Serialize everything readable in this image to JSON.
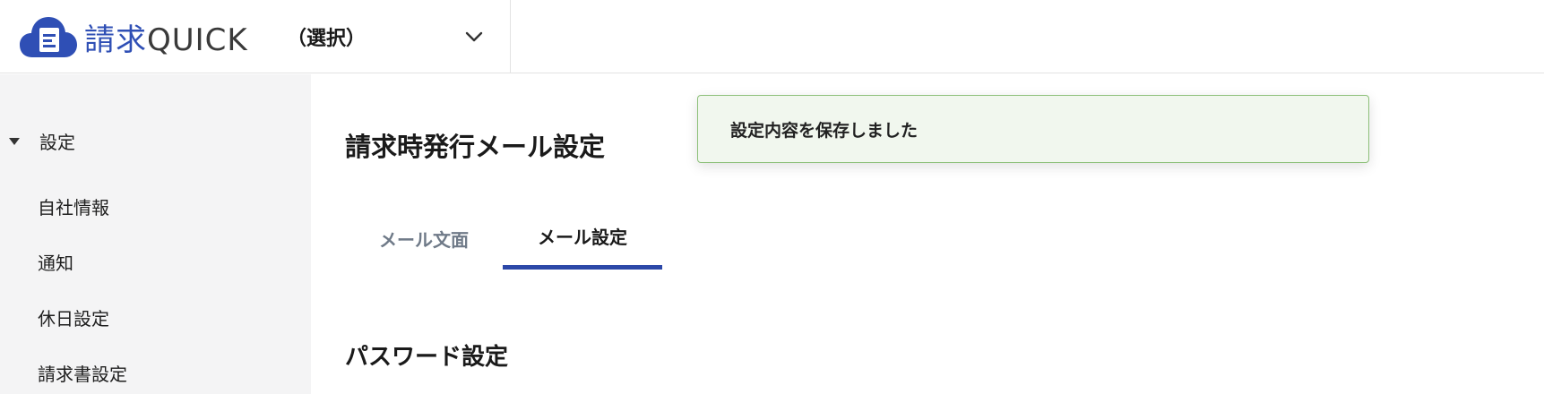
{
  "header": {
    "logo_kanji": "請求",
    "logo_latin": "QUICK",
    "company_select_label": "（選択）",
    "brand_color": "#2f4fb5"
  },
  "sidebar": {
    "section_label": "設定",
    "items": [
      {
        "label": "自社情報"
      },
      {
        "label": "通知"
      },
      {
        "label": "休日設定"
      },
      {
        "label": "請求書設定"
      }
    ]
  },
  "main": {
    "page_title": "請求時発行メール設定",
    "tabs": [
      {
        "label": "メール文面",
        "active": false
      },
      {
        "label": "メール設定",
        "active": true
      }
    ],
    "section_title": "パスワード設定",
    "accent_color": "#2c48a8"
  },
  "toast": {
    "message": "設定内容を保存しました",
    "border_color": "#8dc07a",
    "background_color": "#f1f7ee"
  }
}
